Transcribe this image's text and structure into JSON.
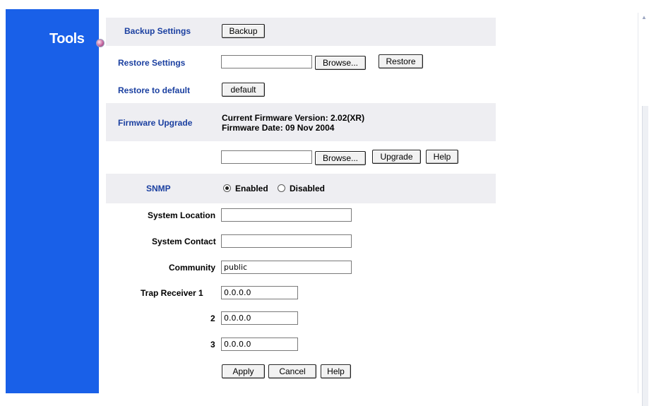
{
  "sidebar": {
    "title": "Tools"
  },
  "tools": {
    "backup": {
      "label": "Backup Settings",
      "button": "Backup"
    },
    "restore": {
      "label": "Restore Settings",
      "browse": "Browse...",
      "button": "Restore",
      "file_value": ""
    },
    "defaults": {
      "label": "Restore to default",
      "button": "default"
    },
    "firmware": {
      "label": "Firmware Upgrade",
      "version": "Current Firmware Version: 2.02(XR)",
      "date": "Firmware Date: 09 Nov 2004",
      "file_value": "",
      "browse": "Browse...",
      "upgrade": "Upgrade",
      "help": "Help"
    }
  },
  "snmp": {
    "label": "SNMP",
    "enabled_label": "Enabled",
    "disabled_label": "Disabled",
    "selected": "Enabled",
    "system_location_label": "System Location",
    "system_location_value": "",
    "system_contact_label": "System Contact",
    "system_contact_value": "",
    "community_label": "Community",
    "community_value": "public",
    "trap1_label": "Trap Receiver 1",
    "trap1_value": "0.0.0.0",
    "trap2_label": "2",
    "trap2_value": "0.0.0.0",
    "trap3_label": "3",
    "trap3_value": "0.0.0.0"
  },
  "actions": {
    "apply": "Apply",
    "cancel": "Cancel",
    "help": "Help"
  },
  "colors": {
    "sidebar": "#1960e8",
    "band": "#eeeef2",
    "label_blue": "#1a3fa0"
  }
}
